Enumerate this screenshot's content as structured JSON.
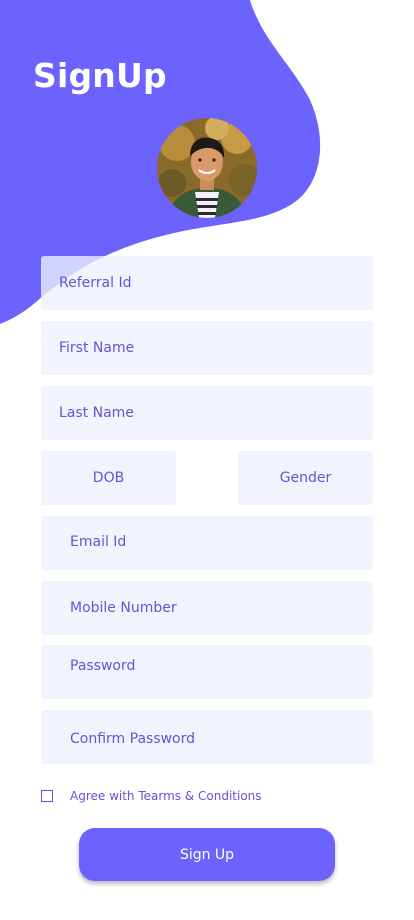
{
  "header": {
    "title": "SignUp"
  },
  "avatar": {
    "name": "avatar"
  },
  "form": {
    "referral_placeholder": "Referral Id",
    "first_name_placeholder": "First Name",
    "last_name_placeholder": "Last Name",
    "dob_placeholder": "DOB",
    "gender_placeholder": "Gender",
    "email_placeholder": "Email Id",
    "mobile_placeholder": "Mobile Number",
    "password_placeholder": "Password",
    "confirm_password_placeholder": "Confirm Password",
    "agree_label": "Agree with Tearms & Conditions",
    "submit_label": "Sign Up"
  },
  "colors": {
    "accent": "#6C63FF",
    "input_bg": "#EDF1FD",
    "text": "#5F57D6",
    "background": "#FFFFFF"
  }
}
